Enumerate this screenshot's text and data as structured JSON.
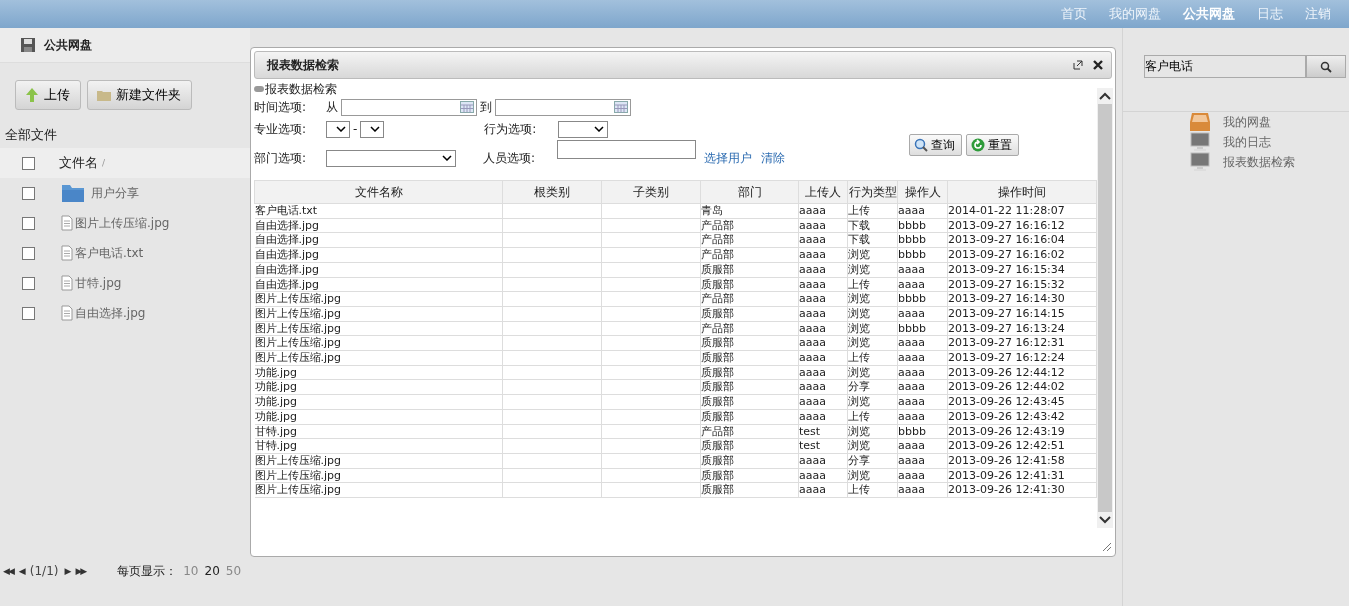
{
  "top_nav": [
    {
      "label": "首页",
      "selected": false
    },
    {
      "label": "我的网盘",
      "selected": false
    },
    {
      "label": "公共网盘",
      "selected": true
    },
    {
      "label": "日志",
      "selected": false
    },
    {
      "label": "注销",
      "selected": false
    }
  ],
  "left": {
    "title": "公共网盘",
    "buttons": [
      {
        "label": "上传",
        "kind": "upload"
      },
      {
        "label": "新建文件夹",
        "kind": "folder"
      }
    ],
    "breadcrumb": "全部文件",
    "header": {
      "label": "文件名",
      "sort_mark": "/",
      "checked": false
    },
    "files": [
      {
        "name": "用户分享",
        "kind": "folder",
        "checked": false
      },
      {
        "name": "图片上传压缩.jpg",
        "kind": "file",
        "checked": false
      },
      {
        "name": "客户电话.txt",
        "kind": "file",
        "checked": false
      },
      {
        "name": "甘特.jpg",
        "kind": "file",
        "checked": false
      },
      {
        "name": "自由选择.jpg",
        "kind": "file",
        "checked": false
      }
    ],
    "pager": {
      "first": "◀◀",
      "prev": "◀",
      "page": "(1/1)",
      "next": "▶",
      "last": "▶▶",
      "per_page_label": "每页显示：",
      "sizes": [
        {
          "label": "10",
          "selected": false
        },
        {
          "label": "20",
          "selected": true
        },
        {
          "label": "50",
          "selected": false
        }
      ]
    }
  },
  "dialog": {
    "title": "报表数据检索",
    "subtitle": "报表数据检索",
    "form": {
      "time_label": "时间选项:",
      "from": "从",
      "to": "到",
      "major_label": "专业选项:",
      "dash": "-",
      "action_label": "行为选项:",
      "dept_label": "部门选项:",
      "person_label": "人员选项:",
      "select_user": "选择用户",
      "clear": "清除",
      "query": "查询",
      "reset": "重置"
    },
    "table": {
      "columns": [
        "文件名称",
        "根类别",
        "子类别",
        "部门",
        "上传人",
        "行为类型",
        "操作人",
        "操作时间"
      ],
      "rows": [
        [
          "客户电话.txt",
          "",
          "",
          "青岛",
          "aaaa",
          "上传",
          "aaaa",
          "2014-01-22 11:28:07"
        ],
        [
          "自由选择.jpg",
          "",
          "",
          "产品部",
          "aaaa",
          "下载",
          "bbbb",
          "2013-09-27 16:16:12"
        ],
        [
          "自由选择.jpg",
          "",
          "",
          "产品部",
          "aaaa",
          "下载",
          "bbbb",
          "2013-09-27 16:16:04"
        ],
        [
          "自由选择.jpg",
          "",
          "",
          "产品部",
          "aaaa",
          "浏览",
          "bbbb",
          "2013-09-27 16:16:02"
        ],
        [
          "自由选择.jpg",
          "",
          "",
          "质服部",
          "aaaa",
          "浏览",
          "aaaa",
          "2013-09-27 16:15:34"
        ],
        [
          "自由选择.jpg",
          "",
          "",
          "质服部",
          "aaaa",
          "上传",
          "aaaa",
          "2013-09-27 16:15:32"
        ],
        [
          "图片上传压缩.jpg",
          "",
          "",
          "产品部",
          "aaaa",
          "浏览",
          "bbbb",
          "2013-09-27 16:14:30"
        ],
        [
          "图片上传压缩.jpg",
          "",
          "",
          "质服部",
          "aaaa",
          "浏览",
          "aaaa",
          "2013-09-27 16:14:15"
        ],
        [
          "图片上传压缩.jpg",
          "",
          "",
          "产品部",
          "aaaa",
          "浏览",
          "bbbb",
          "2013-09-27 16:13:24"
        ],
        [
          "图片上传压缩.jpg",
          "",
          "",
          "质服部",
          "aaaa",
          "浏览",
          "aaaa",
          "2013-09-27 16:12:31"
        ],
        [
          "图片上传压缩.jpg",
          "",
          "",
          "质服部",
          "aaaa",
          "上传",
          "aaaa",
          "2013-09-27 16:12:24"
        ],
        [
          "功能.jpg",
          "",
          "",
          "质服部",
          "aaaa",
          "浏览",
          "aaaa",
          "2013-09-26 12:44:12"
        ],
        [
          "功能.jpg",
          "",
          "",
          "质服部",
          "aaaa",
          "分享",
          "aaaa",
          "2013-09-26 12:44:02"
        ],
        [
          "功能.jpg",
          "",
          "",
          "质服部",
          "aaaa",
          "浏览",
          "aaaa",
          "2013-09-26 12:43:45"
        ],
        [
          "功能.jpg",
          "",
          "",
          "质服部",
          "aaaa",
          "上传",
          "aaaa",
          "2013-09-26 12:43:42"
        ],
        [
          "甘特.jpg",
          "",
          "",
          "产品部",
          "test",
          "浏览",
          "bbbb",
          "2013-09-26 12:43:19"
        ],
        [
          "甘特.jpg",
          "",
          "",
          "质服部",
          "test",
          "浏览",
          "aaaa",
          "2013-09-26 12:42:51"
        ],
        [
          "图片上传压缩.jpg",
          "",
          "",
          "质服部",
          "aaaa",
          "分享",
          "aaaa",
          "2013-09-26 12:41:58"
        ],
        [
          "图片上传压缩.jpg",
          "",
          "",
          "质服部",
          "aaaa",
          "浏览",
          "aaaa",
          "2013-09-26 12:41:31"
        ],
        [
          "图片上传压缩.jpg",
          "",
          "",
          "质服部",
          "aaaa",
          "上传",
          "aaaa",
          "2013-09-26 12:41:30"
        ]
      ]
    }
  },
  "right": {
    "search": {
      "value": "客户电话"
    },
    "links": [
      {
        "label": "我的网盘",
        "kind": "disk"
      },
      {
        "label": "我的日志",
        "kind": "monitor"
      },
      {
        "label": "报表数据检索",
        "kind": "monitor"
      }
    ]
  }
}
